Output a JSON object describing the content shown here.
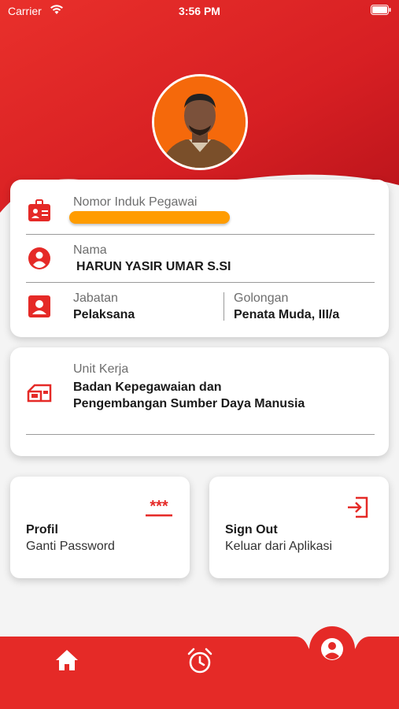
{
  "status_bar": {
    "carrier": "Carrier",
    "time": "3:56 PM"
  },
  "profile": {
    "nip_label": "Nomor Induk Pegawai",
    "nip_value": "",
    "nama_label": "Nama",
    "nama_value": "HARUN YASIR UMAR S.SI",
    "jabatan_label": "Jabatan",
    "jabatan_value": "Pelaksana",
    "golongan_label": "Golongan",
    "golongan_value": "Penata Muda, III/a"
  },
  "unit": {
    "label": "Unit Kerja",
    "value": "Badan Kepegawaian dan Pengembangan Sumber Daya Manusia"
  },
  "actions": [
    {
      "title": "Profil",
      "subtitle": "Ganti Password",
      "icon": "password-icon"
    },
    {
      "title": "Sign Out",
      "subtitle": "Keluar dari Aplikasi",
      "icon": "sign-out-icon"
    }
  ],
  "bottom_nav": [
    {
      "icon": "home-icon"
    },
    {
      "icon": "alarm-clock-icon"
    },
    {
      "icon": "profile-icon",
      "active": true
    }
  ],
  "colors": {
    "brand": "#e52a27",
    "highlight": "#ff9c00",
    "background": "#f4f4f4"
  }
}
